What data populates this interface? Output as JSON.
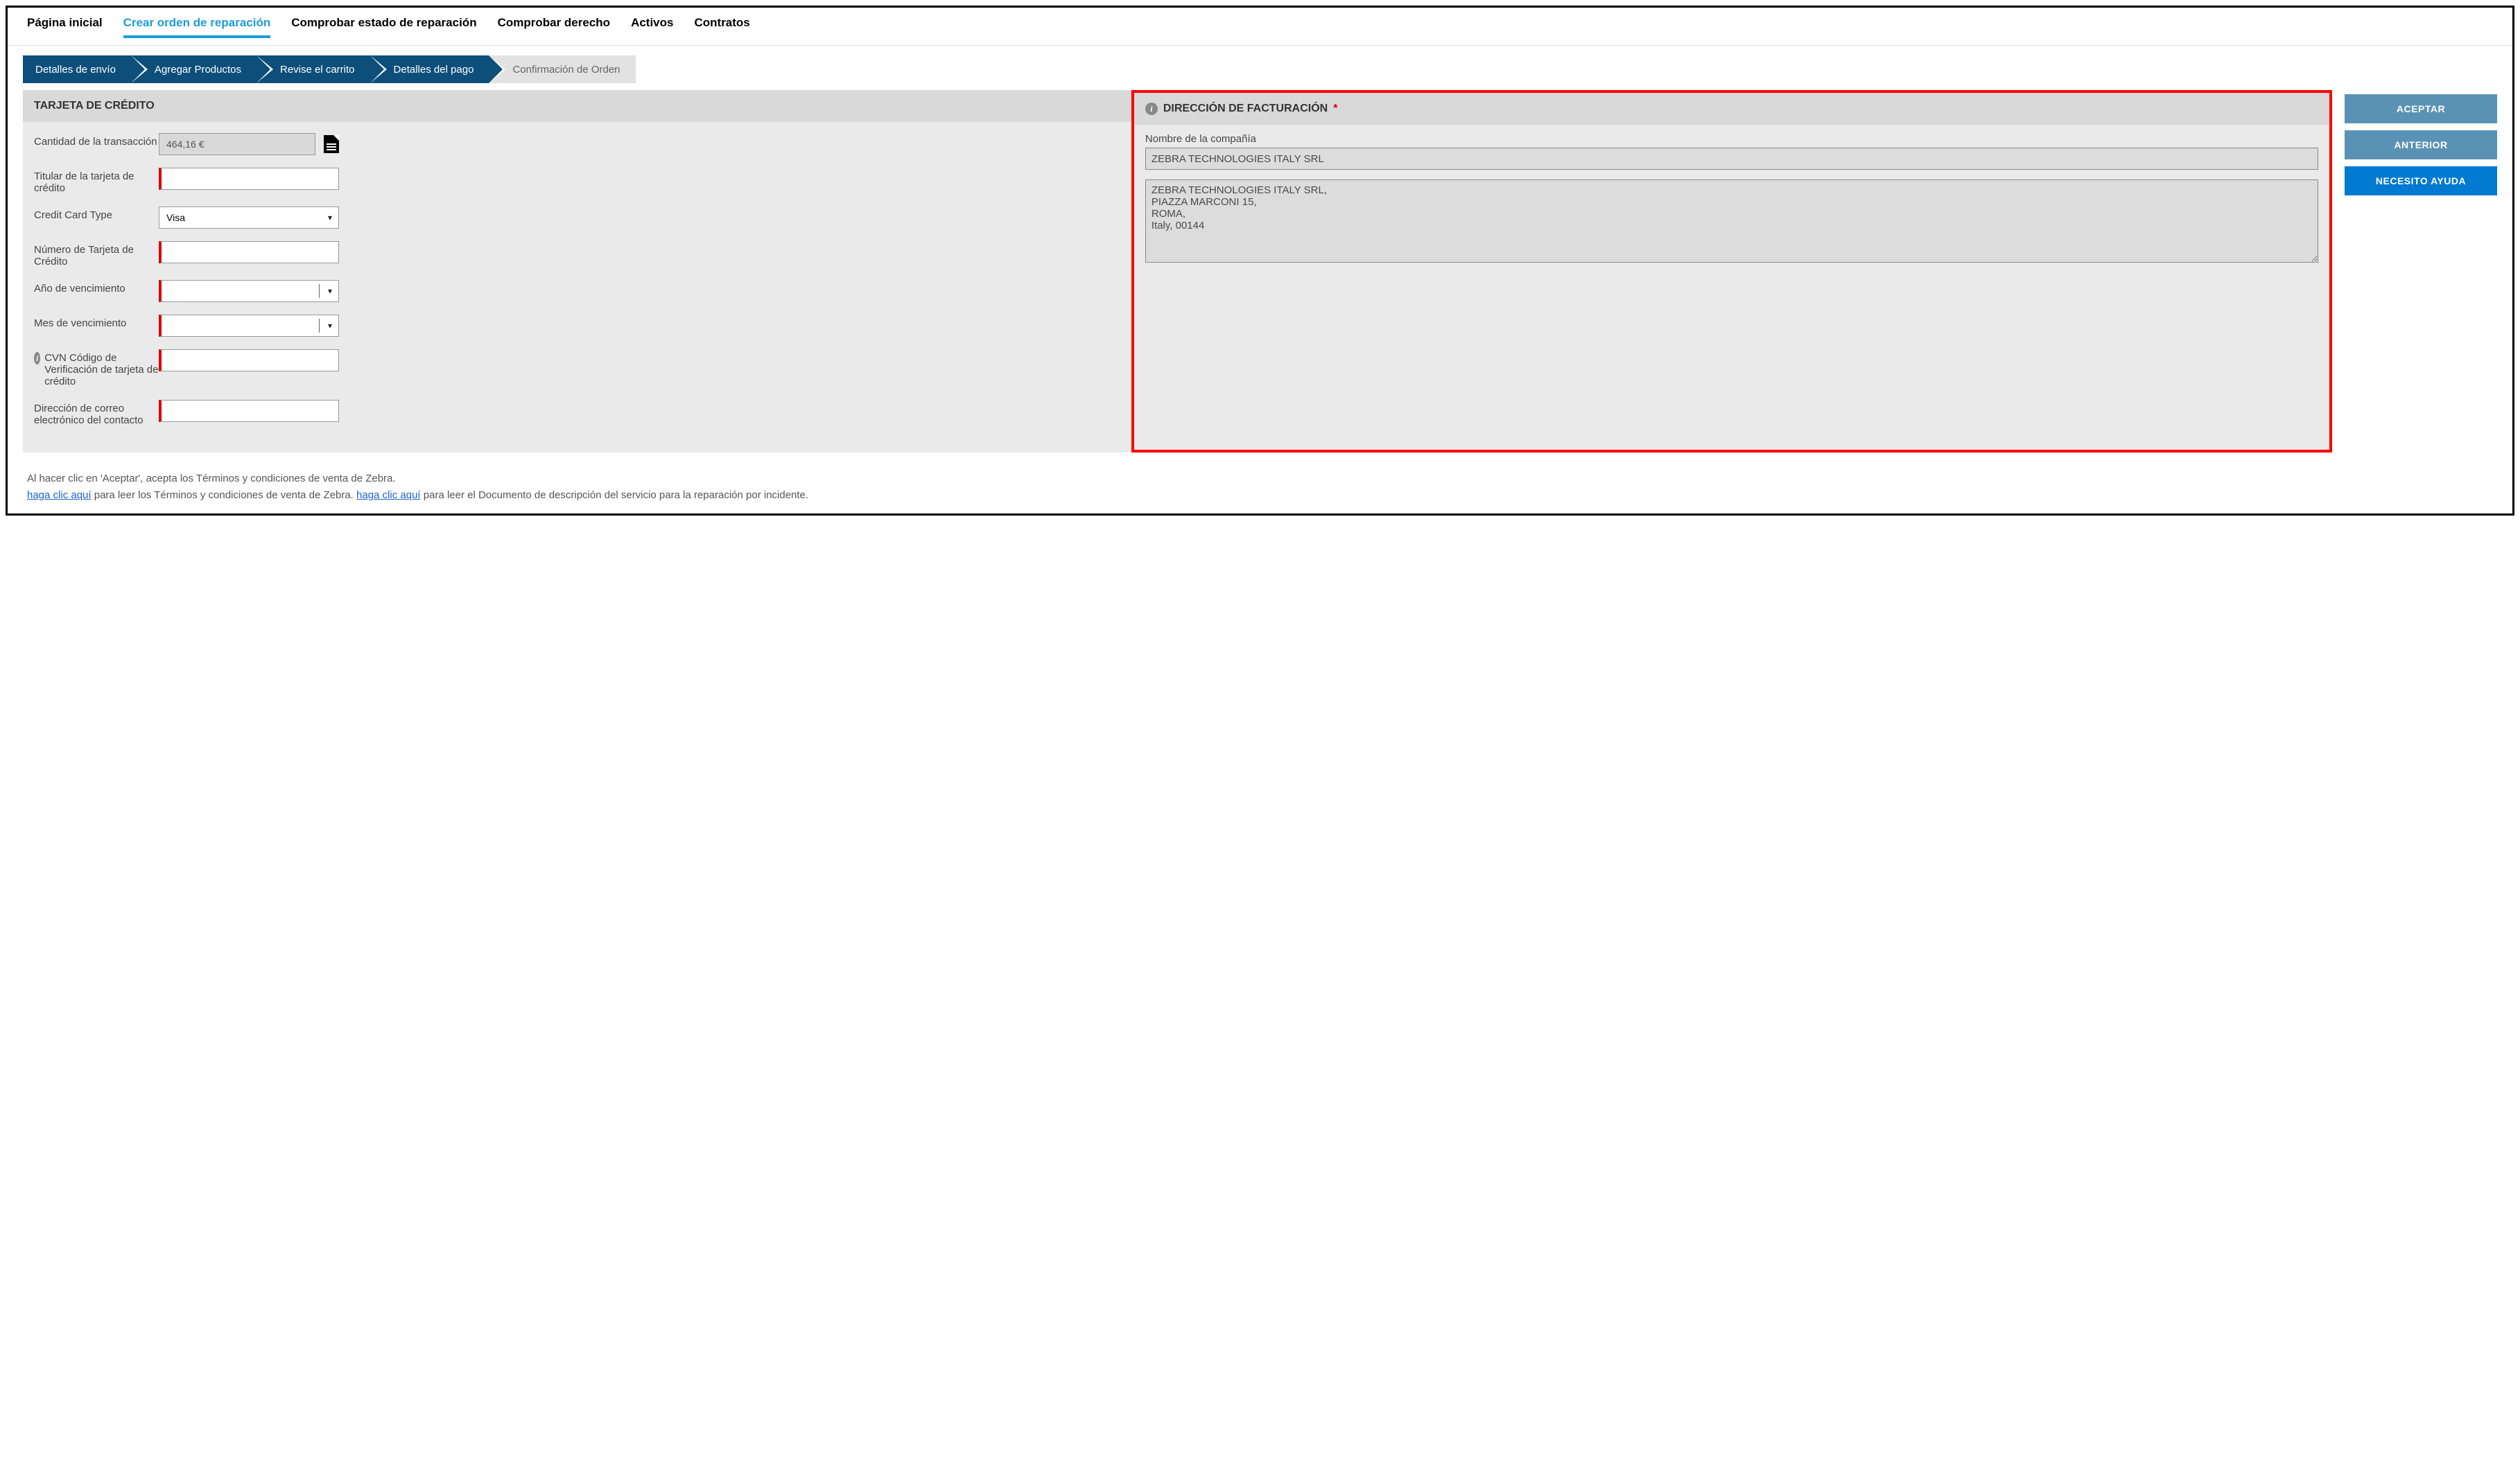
{
  "topNav": {
    "home": "Página inicial",
    "createOrder": "Crear orden de reparación",
    "checkStatus": "Comprobar estado de reparación",
    "checkRight": "Comprobar derecho",
    "assets": "Activos",
    "contracts": "Contratos"
  },
  "wizard": {
    "step1": "Detalles de envío",
    "step2": "Agregar Productos",
    "step3": "Revise el carrito",
    "step4": "Detalles del pago",
    "step5": "Confirmación de Orden"
  },
  "creditCard": {
    "header": "TARJETA DE CRÉDITO",
    "amountLabel": "Cantidad de la transacción",
    "amountValue": "464,16 €",
    "holderLabel": "Titular de la tarjeta de crédito",
    "holderValue": "",
    "typeLabel": "Credit Card Type",
    "typeValue": "Visa",
    "numberLabel": "Número de Tarjeta de Crédito",
    "numberValue": "",
    "expYearLabel": "Año de vencimiento",
    "expYearValue": "",
    "expMonthLabel": "Mes de vencimiento",
    "expMonthValue": "",
    "cvnLabel": "CVN Código de Verificación de tarjeta de crédito",
    "cvnValue": "",
    "emailLabel": "Dirección de correo electrónico del contacto",
    "emailValue": ""
  },
  "billing": {
    "header": "DIRECCIÓN DE FACTURACIÓN",
    "companyLabel": "Nombre de la compañía",
    "companyValue": "ZEBRA TECHNOLOGIES ITALY SRL",
    "addressValue": "ZEBRA TECHNOLOGIES ITALY SRL,\nPIAZZA MARCONI 15,\nROMA,\nItaly, 00144"
  },
  "buttons": {
    "accept": "ACEPTAR",
    "previous": "ANTERIOR",
    "help": "NECESITO AYUDA"
  },
  "footer": {
    "line1": "Al hacer clic en 'Aceptar', acepta los Términos y condiciones de venta de Zebra.",
    "link1": "haga clic aquí",
    "mid1": " para leer los Términos y condiciones de venta de Zebra. ",
    "link2": " haga clic aquí",
    "mid2": " para leer el Documento de descripción del servicio para la reparación por incidente."
  }
}
